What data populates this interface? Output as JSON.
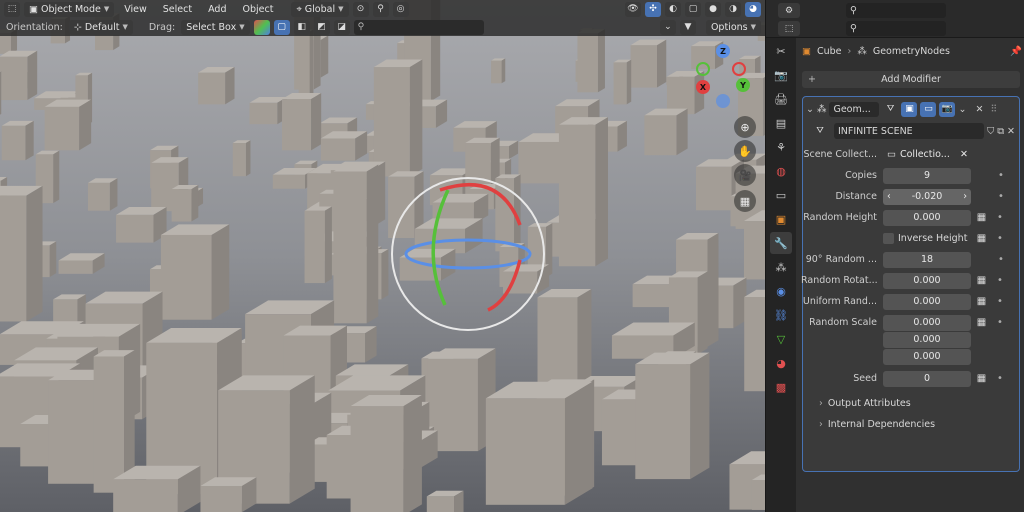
{
  "viewport": {
    "header": {
      "mode": "Object Mode",
      "menus": [
        "View",
        "Select",
        "Add",
        "Object"
      ],
      "transform_orientation": "Global"
    },
    "toolbar": {
      "orientation_label": "Orientation:",
      "orientation_value": "Default",
      "drag_label": "Drag:",
      "drag_value": "Select Box",
      "options_label": "Options"
    },
    "gizmo": {
      "z": "Z",
      "y": "Y",
      "x": "X"
    }
  },
  "properties": {
    "breadcrumb": {
      "object": "Cube",
      "modifier": "GeometryNodes"
    },
    "add_modifier": "Add Modifier",
    "modifier": {
      "name": "Geom...",
      "node_group": "INFINITE SCENE",
      "fields": [
        {
          "label": "Scene Collect...",
          "value": "Collectio..."
        },
        {
          "label": "Copies",
          "value": "9"
        },
        {
          "label": "Distance",
          "value": "-0.020"
        },
        {
          "label": "Random Height",
          "value": "0.000"
        },
        {
          "label": "",
          "value": "Inverse Height"
        },
        {
          "label": "90° Random ...",
          "value": "18"
        },
        {
          "label": "Random Rotat...",
          "value": "0.000"
        },
        {
          "label": "Uniform Rand...",
          "value": "0.000"
        },
        {
          "label": "Random Scale",
          "value": "0.000"
        },
        {
          "label": "",
          "value": "0.000"
        },
        {
          "label": "",
          "value": "0.000"
        },
        {
          "label": "Seed",
          "value": "0"
        }
      ],
      "subpanels": [
        "Output Attributes",
        "Internal Dependencies"
      ]
    }
  }
}
